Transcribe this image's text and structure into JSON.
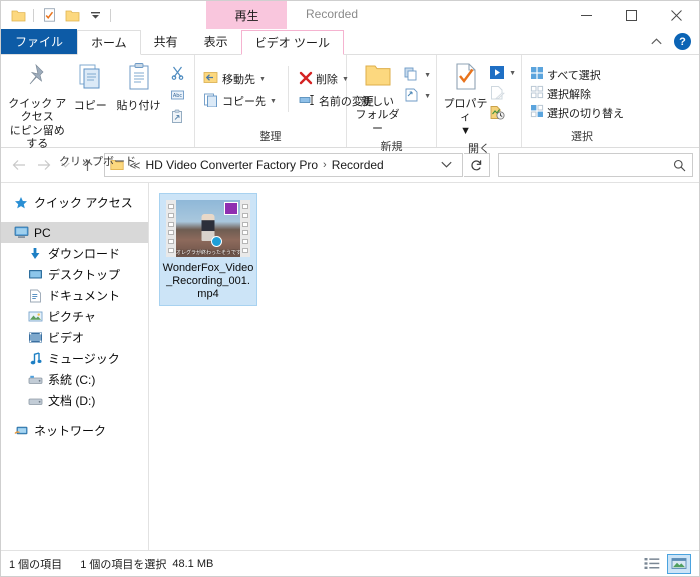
{
  "window": {
    "title": "Recorded",
    "minimize_label": "─",
    "maximize_label": "□",
    "close_label": "✕",
    "collapse_ribbon_label": "⌃",
    "help_label": "?"
  },
  "quick_access": {
    "items": [
      {
        "name": "folder-icon",
        "label": ""
      },
      {
        "name": "properties-icon",
        "label": ""
      },
      {
        "name": "new-folder-icon",
        "label": ""
      },
      {
        "name": "customize-dropdown-icon",
        "label": "▾"
      }
    ]
  },
  "tabs": [
    {
      "id": "file",
      "label": "ファイル"
    },
    {
      "id": "home",
      "label": "ホーム"
    },
    {
      "id": "share",
      "label": "共有"
    },
    {
      "id": "view",
      "label": "表示"
    },
    {
      "id": "video-tools",
      "label": "ビデオ ツール"
    }
  ],
  "contextual_tab": {
    "label": "再生",
    "color": "#f9c6dd"
  },
  "ribbon": {
    "groups": [
      {
        "id": "clipboard",
        "label": "クリップボード",
        "pin_label": "クイック アクセス\nにピン留めする",
        "pin_label_line1": "クイック アクセス",
        "pin_label_line2": "にピン留めする",
        "copy_label": "コピー",
        "paste_label": "貼り付け",
        "cut_name": "cut-icon",
        "copy_path_name": "copy-path-icon",
        "paste_shortcut_name": "paste-shortcut-icon"
      },
      {
        "id": "organize",
        "label": "整理",
        "move_to_label": "移動先",
        "copy_to_label": "コピー先",
        "delete_label": "削除",
        "rename_label": "名前の変更"
      },
      {
        "id": "new",
        "label": "新規",
        "new_folder_line1": "新しい",
        "new_folder_line2": "フォルダー",
        "new_item_name": "new-item-icon",
        "easy_access_name": "easy-access-icon"
      },
      {
        "id": "open",
        "label": "開く",
        "properties_label": "プロパティ",
        "open_with_name": "open-with-icon",
        "edit_name": "edit-icon",
        "history_name": "history-icon"
      },
      {
        "id": "select",
        "label": "選択",
        "select_all_label": "すべて選択",
        "select_none_label": "選択解除",
        "invert_selection_label": "選択の切り替え"
      }
    ]
  },
  "address_bar": {
    "back_label": "←",
    "forward_label": "→",
    "recent_label": "⌄",
    "up_label": "↑",
    "breadcrumb_prefix": "≪",
    "crumbs": [
      "HD Video Converter Factory Pro",
      "Recorded"
    ],
    "crumb_separator": "›",
    "dropdown_label": "⌄",
    "refresh_label": "↻"
  },
  "search": {
    "value": "",
    "placeholder": "",
    "icon_name": "search-icon"
  },
  "sidebar": {
    "items": [
      {
        "id": "quick-access",
        "label": "クイック アクセス",
        "icon": "star-icon",
        "indent": false,
        "selected": false
      },
      {
        "id": "pc",
        "label": "PC",
        "icon": "pc-icon",
        "indent": false,
        "selected": true
      },
      {
        "id": "downloads",
        "label": "ダウンロード",
        "icon": "download-icon",
        "indent": true,
        "selected": false
      },
      {
        "id": "desktop",
        "label": "デスクトップ",
        "icon": "desktop-icon",
        "indent": true,
        "selected": false
      },
      {
        "id": "documents",
        "label": "ドキュメント",
        "icon": "documents-icon",
        "indent": true,
        "selected": false
      },
      {
        "id": "pictures",
        "label": "ピクチャ",
        "icon": "pictures-icon",
        "indent": true,
        "selected": false
      },
      {
        "id": "videos",
        "label": "ビデオ",
        "icon": "videos-icon",
        "indent": true,
        "selected": false
      },
      {
        "id": "music",
        "label": "ミュージック",
        "icon": "music-icon",
        "indent": true,
        "selected": false
      },
      {
        "id": "drive-c",
        "label": "系統 (C:)",
        "icon": "drive-icon",
        "indent": true,
        "selected": false
      },
      {
        "id": "drive-d",
        "label": "文档 (D:)",
        "icon": "drive-icon",
        "indent": true,
        "selected": false
      },
      {
        "id": "network",
        "label": "ネットワーク",
        "icon": "network-icon",
        "indent": false,
        "selected": false
      }
    ]
  },
  "files": [
    {
      "name": "WonderFox_Video_Recording_001.mp4",
      "type": "video",
      "selected": true,
      "thumbnail_caption": "オレグラが終わったそうです"
    }
  ],
  "status_bar": {
    "item_count": "1 個の項目",
    "selection": "1 個の項目を選択",
    "size": "48.1 MB",
    "views": [
      {
        "id": "details-view",
        "label": "",
        "active": false
      },
      {
        "id": "large-icons-view",
        "label": "",
        "active": true
      }
    ]
  },
  "colors": {
    "file_tab": "#0d5ba6",
    "contextual_pink": "#f9c6dd",
    "selection_blue": "#cce4f7",
    "help_blue": "#0b64b5",
    "delete_red": "#d42222",
    "folder_yellow": "#ffd672"
  }
}
